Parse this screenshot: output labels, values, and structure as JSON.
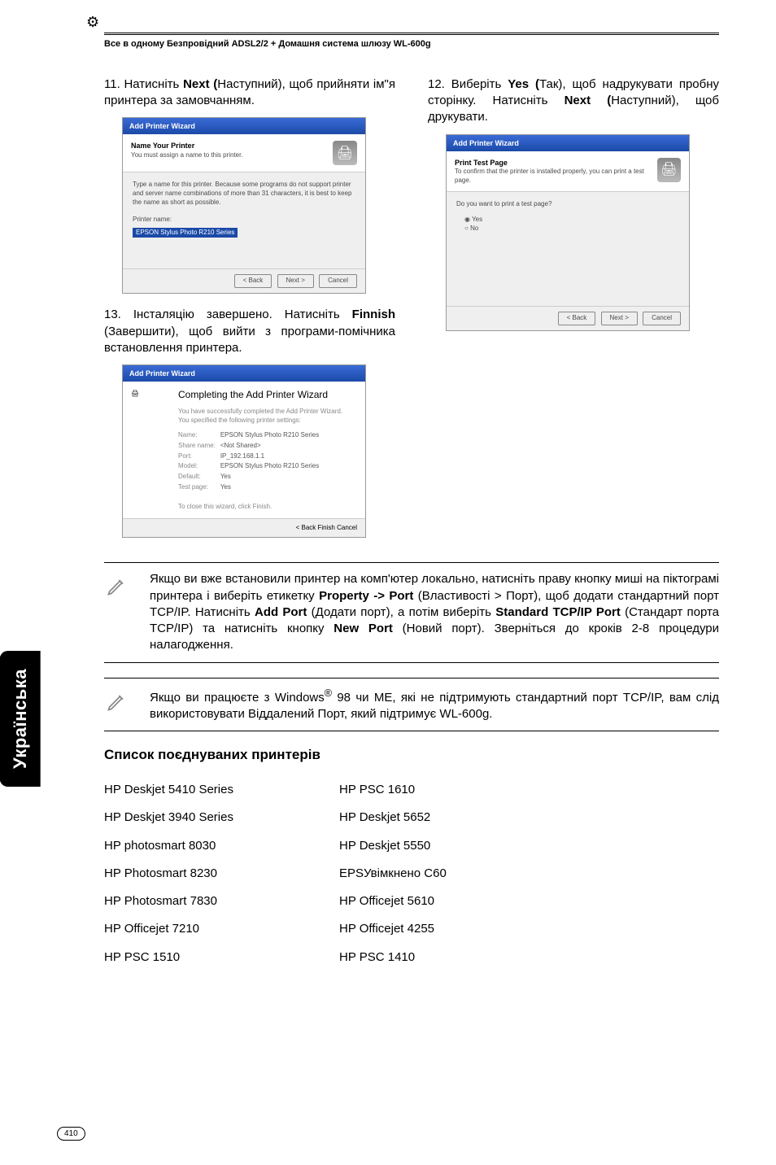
{
  "header": {
    "text": "Все в одному Безпровідний ADSL2/2 + Домашня система шлюзу WL-600g"
  },
  "side_tab": "Українська",
  "page_number": "410",
  "left": {
    "step11": {
      "num": "11.",
      "pre": "Натисніть ",
      "btn": "Next (",
      "post1": "Наступний), щоб прийняти ім\"я принтера за замовчанням."
    },
    "dlg_name": {
      "bar": "Add Printer Wizard",
      "title": "Name Your Printer",
      "sub": "You must assign a name to this printer.",
      "desc": "Type a name for this printer. Because some programs do not support printer and server name combinations of more than 31 characters, it is best to keep the name as short as possible.",
      "field_label": "Printer name:",
      "field_value": "EPSON Stylus Photo R210 Series",
      "btn_back": "< Back",
      "btn_next": "Next >",
      "btn_cancel": "Cancel"
    },
    "step13": {
      "num": "13.",
      "text": "Інсталяцію завершено. Натисніть ",
      "btn": "Finnish",
      "post": " (Завершити), щоб вийти з програми-помічника встановлення принтера."
    },
    "dlg_done": {
      "bar": "Add Printer Wizard",
      "title": "Completing the Add Printer Wizard",
      "sub1": "You have successfully completed the Add Printer Wizard.",
      "sub2": "You specified the following printer settings:",
      "rows": [
        [
          "Name:",
          "EPSON Stylus Photo R210 Series"
        ],
        [
          "Share name:",
          "<Not Shared>"
        ],
        [
          "Port:",
          "IP_192.168.1.1"
        ],
        [
          "Model:",
          "EPSON Stylus Photo R210 Series"
        ],
        [
          "Default:",
          "Yes"
        ],
        [
          "Test page:",
          "Yes"
        ]
      ],
      "close": "To close this wizard, click Finish.",
      "btn_back": "< Back",
      "btn_finish": "Finish",
      "btn_cancel": "Cancel"
    }
  },
  "right": {
    "step12": {
      "num": "12.",
      "pre": "Виберіть ",
      "btn1": "Yes (",
      "mid": "Так), щоб надрукувати пробну сторінку. Натисніть ",
      "btn2": "Next (",
      "post": "Наступний), щоб друкувати."
    },
    "dlg_test": {
      "bar": "Add Printer Wizard",
      "title": "Print Test Page",
      "sub": "To confirm that the printer is installed properly, you can print a test page.",
      "q": "Do you want to print a test page?",
      "opt_yes": "Yes",
      "opt_no": "No",
      "btn_back": "< Back",
      "btn_next": "Next >",
      "btn_cancel": "Cancel"
    }
  },
  "note1": {
    "text_parts": [
      "Якщо ви вже встановили принтер на комп'ютер локально, натисніть праву кнопку миші на піктограмі принтера і виберіть етикетку ",
      "Property -> Port",
      " (Властивості > Порт), щоб додати стандартний порт TCP/IP. Натисніть ",
      "Add Port",
      " (Додати порт), а потім виберіть ",
      "Standard TCP/IP Port",
      " (Стандарт порта TCP/IP) та натисніть кнопку ",
      "New Port",
      " (Новий порт). Зверніться до кроків 2-8 процедури налагодження."
    ]
  },
  "note2": {
    "pre": "Якщо ви працюєте з Windows",
    "sup": "®",
    "mid": " 98 чи МЕ, які не підтримують стандартний порт TCP/IP, вам слід використовувати Віддалений Порт, який підтримує WL-600g."
  },
  "printers_title": "Список поєднуваних принтерів",
  "printers_left": [
    "HP Deskjet 5410 Series",
    "HP Deskjet 3940 Series",
    "HP photosmart 8030",
    "HP Photosmart 8230",
    "HP Photosmart 7830",
    "HP Officejet  7210",
    "HP PSC 1510"
  ],
  "printers_right": [
    "HP PSC 1610",
    "HP Deskjet 5652",
    "HP Deskjet 5550",
    "EPSУвімкнено C60",
    "HP Officejet 5610",
    "HP Officejet 4255",
    "HP  PSC 1410"
  ]
}
